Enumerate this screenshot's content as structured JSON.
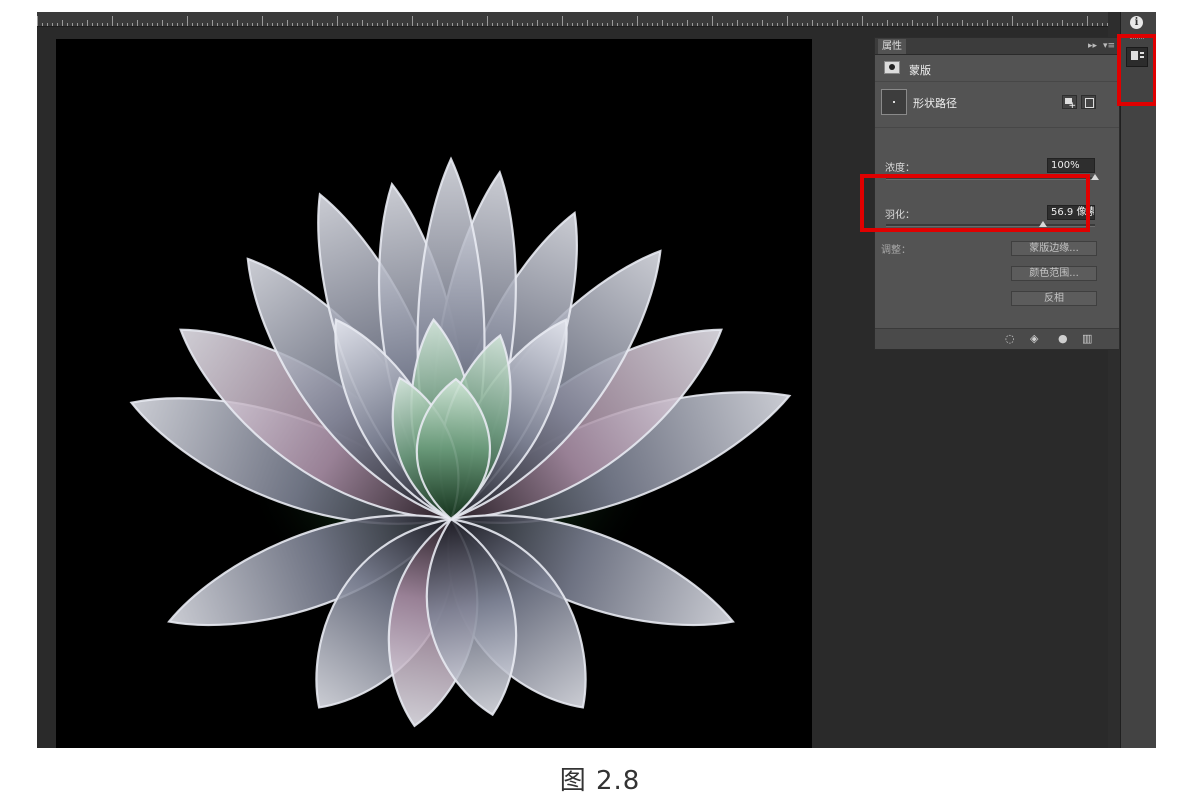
{
  "properties_panel": {
    "tab_title": "属性",
    "collapse_glyph": "▸▸",
    "menu_glyph": "▾≡",
    "mask_label": "蒙版",
    "shape_path_label": "形状路径",
    "density": {
      "label": "浓度：",
      "value": "100%",
      "level": 1.0
    },
    "feather": {
      "label": "羽化：",
      "value": "56.9 像素",
      "level": 0.75
    },
    "adjust_label": "调整：",
    "buttons": {
      "mask_edge": "蒙版边缘...",
      "color_range": "颜色范围...",
      "invert": "反相"
    },
    "footer_icons": [
      "selection-icon",
      "apply-mask-icon",
      "visibility-icon",
      "delete-icon"
    ]
  },
  "dock": {
    "info_glyph": "i"
  },
  "caption": "图  2.8",
  "colors": {
    "highlight": "#e00000",
    "panel": "#535353",
    "workspace": "#282828"
  }
}
